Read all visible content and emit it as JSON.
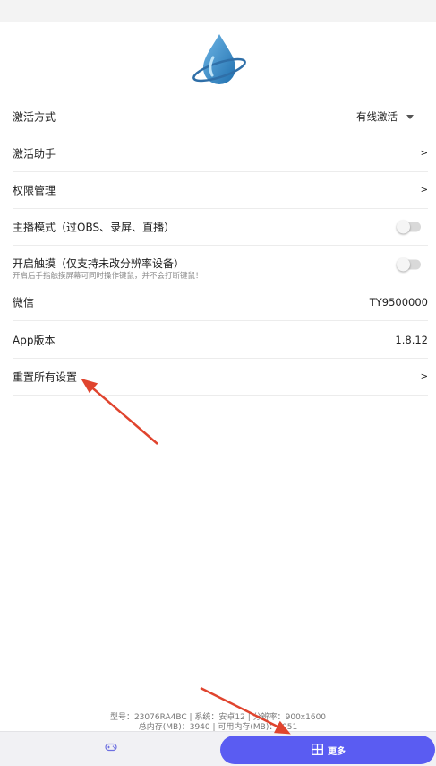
{
  "settings": {
    "activation_mode": {
      "label": "激活方式",
      "value": "有线激活"
    },
    "activation_helper": {
      "label": "激活助手",
      "chevron": ">"
    },
    "permission_management": {
      "label": "权限管理",
      "chevron": ">"
    },
    "streamer_mode": {
      "label": "主播模式（过OBS、录屏、直播）",
      "enabled": false
    },
    "enable_touch": {
      "label": "开启触摸（仅支持未改分辨率设备）",
      "hint": "开启后手指触摸屏幕可同时操作键鼠，并不会打断键鼠！",
      "enabled": false
    },
    "wechat": {
      "label": "微信",
      "value": "TY9500000"
    },
    "app_version": {
      "label": "App版本",
      "value": "1.8.12"
    },
    "reset_all": {
      "label": "重置所有设置",
      "chevron": ">"
    }
  },
  "device_info": {
    "line1": "型号：23076RA4BC | 系统：安卓12 | 分辨率：900x1600",
    "line2": "总内存(MB)：3940 | 可用内存(MB)：2051"
  },
  "bottom_nav": {
    "game_tab_icon": "gamepad-icon",
    "more_tab_label": "更多",
    "more_tab_icon": "grid-icon"
  },
  "colors": {
    "accent": "#5a5cf2",
    "annotation_arrow": "#e0442e",
    "logo_blue": "#3a8ed0"
  }
}
